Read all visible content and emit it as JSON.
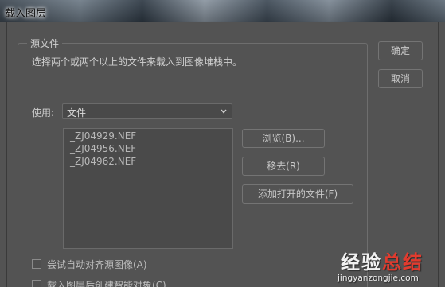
{
  "window": {
    "title": "载入图层"
  },
  "source_group": {
    "title": "源文件",
    "description": "选择两个或两个以上的文件来载入到图像堆栈中。",
    "use_label": "使用:",
    "use_select_value": "文件",
    "files": [
      "_ZJ04929.NEF",
      "_ZJ04956.NEF",
      "_ZJ04962.NEF"
    ]
  },
  "buttons": {
    "ok": "确定",
    "cancel": "取消",
    "browse": "浏览(B)...",
    "remove": "移去(R)",
    "add_open_files": "添加打开的文件(F)"
  },
  "options": {
    "auto_align": "尝试自动对齐源图像(A)",
    "smart_object": "载入图层后创建智能对象(C)"
  },
  "watermark": {
    "text_main": "经验",
    "text_accent": "总结",
    "url": "jingyanzongjie.com"
  }
}
